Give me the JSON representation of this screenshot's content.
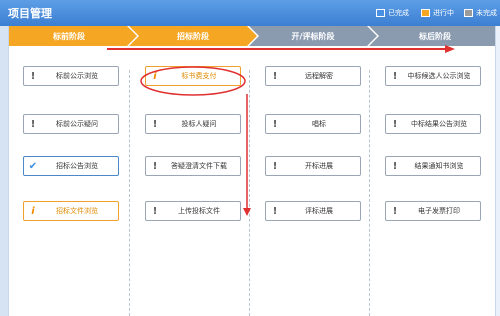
{
  "header": {
    "title": "项目管理"
  },
  "legend": [
    {
      "label": "已完成",
      "color": "#4a90e2"
    },
    {
      "label": "进行中",
      "color": "#f5a623"
    },
    {
      "label": "未完成",
      "color": "#9b9b9b"
    }
  ],
  "stages": [
    {
      "label": "标前阶段",
      "color": "#f5a623"
    },
    {
      "label": "招标阶段",
      "color": "#f5a623"
    },
    {
      "label": "开/评标阶段",
      "color": "#8a9bb0"
    },
    {
      "label": "标后阶段",
      "color": "#8a9bb0"
    }
  ],
  "columns": [
    {
      "items": [
        {
          "label": "标前公示浏览",
          "status": "not_done",
          "icon": "exclamation-icon"
        },
        {
          "label": "标前公示疑问",
          "status": "not_done",
          "icon": "exclamation-icon"
        },
        {
          "label": "招标公告浏览",
          "status": "done",
          "icon": "check-icon"
        },
        {
          "label": "招标文件浏览",
          "status": "in_progress",
          "icon": "info-icon"
        }
      ]
    },
    {
      "items": [
        {
          "label": "标书费支付",
          "status": "in_progress",
          "icon": "info-icon"
        },
        {
          "label": "投标人疑问",
          "status": "not_done",
          "icon": "exclamation-icon"
        },
        {
          "label": "答疑澄清文件下载",
          "status": "not_done",
          "icon": "exclamation-icon"
        },
        {
          "label": "上传投标文件",
          "status": "not_done",
          "icon": "exclamation-icon"
        }
      ]
    },
    {
      "items": [
        {
          "label": "远程解密",
          "status": "not_done",
          "icon": "exclamation-icon"
        },
        {
          "label": "唱标",
          "status": "not_done",
          "icon": "exclamation-icon"
        },
        {
          "label": "开标进展",
          "status": "not_done",
          "icon": "exclamation-icon"
        },
        {
          "label": "评标进展",
          "status": "not_done",
          "icon": "exclamation-icon"
        }
      ]
    },
    {
      "items": [
        {
          "label": "中标候选人公示浏览",
          "status": "not_done",
          "icon": "exclamation-icon"
        },
        {
          "label": "中标结果公告浏览",
          "status": "not_done",
          "icon": "exclamation-icon"
        },
        {
          "label": "结果通知书浏览",
          "status": "not_done",
          "icon": "exclamation-icon"
        },
        {
          "label": "电子发票打印",
          "status": "not_done",
          "icon": "exclamation-icon"
        }
      ]
    }
  ]
}
